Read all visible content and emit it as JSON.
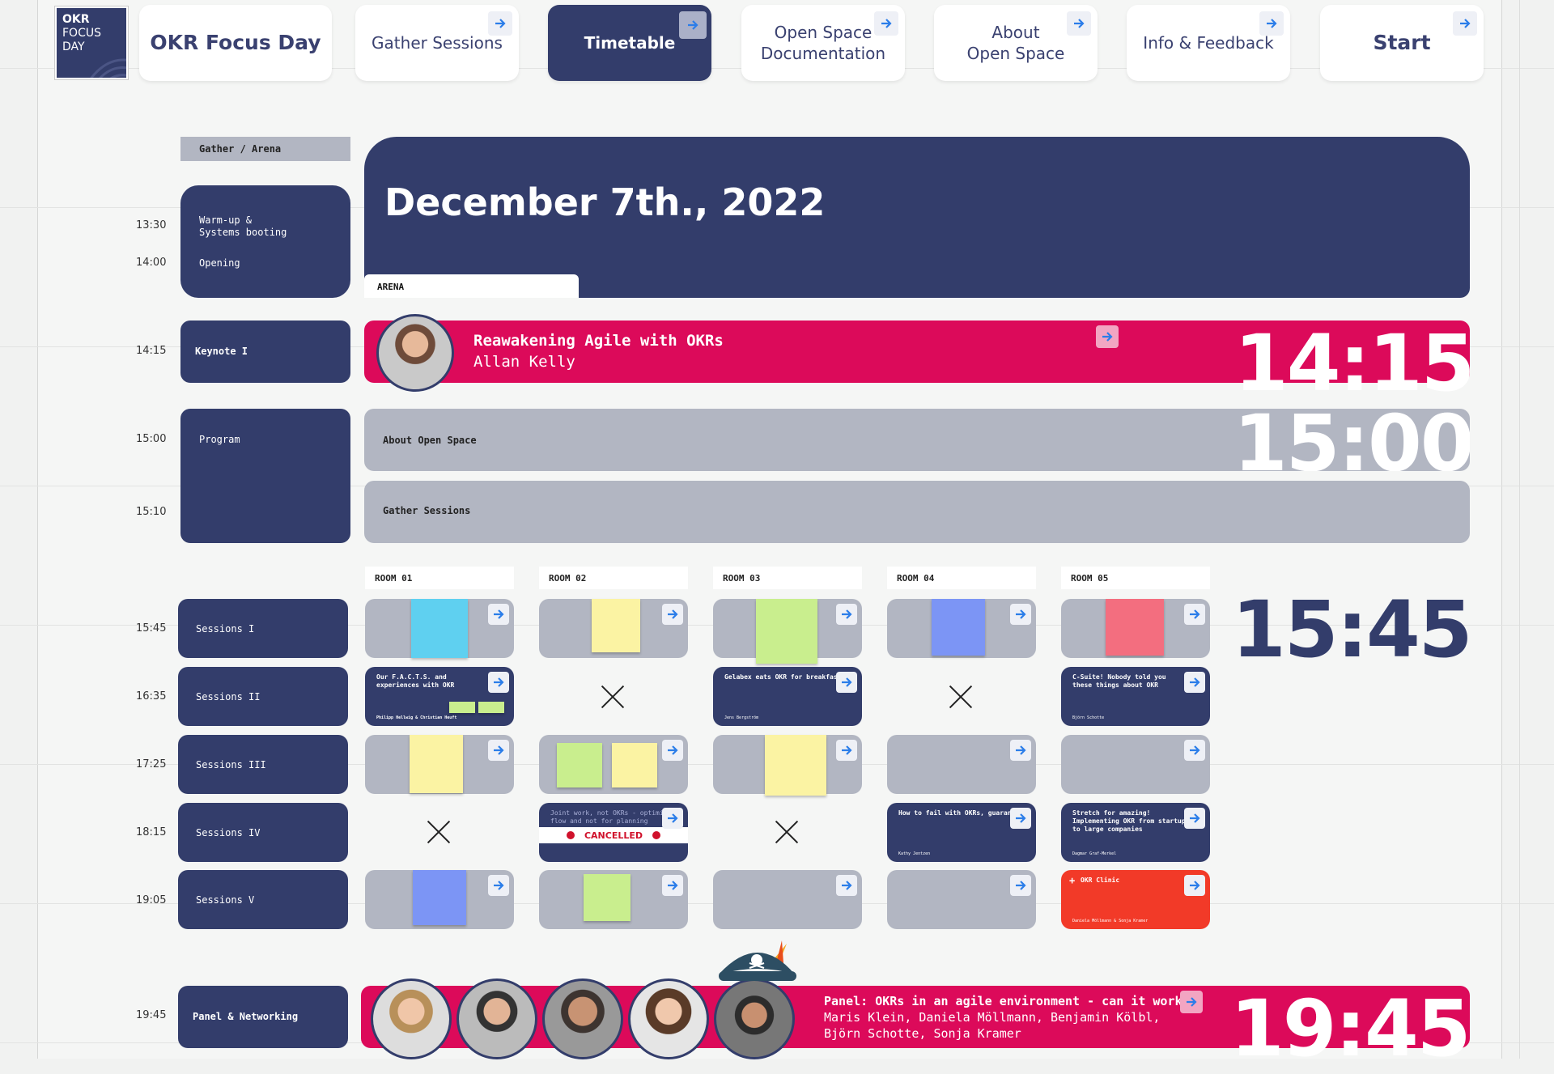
{
  "logo": {
    "line1": "OKR",
    "line2": "FOCUS",
    "line3": "DAY"
  },
  "nav": {
    "title": "OKR Focus Day",
    "gather": "Gather Sessions",
    "timetable": "Timetable",
    "open_space_doc": "Open Space\nDocumentation",
    "about_open_space": "About\nOpen Space",
    "info_feedback": "Info & Feedback",
    "start": "Start"
  },
  "header": {
    "location_tag": "Gather / Arena",
    "date": "December 7th., 2022",
    "arena_tab": "ARENA"
  },
  "times": {
    "t1330": "13:30",
    "t1400": "14:00",
    "t1415": "14:15",
    "t1500": "15:00",
    "t1510": "15:10",
    "t1545": "15:45",
    "t1635": "16:35",
    "t1725": "17:25",
    "t1815": "18:15",
    "t1905": "19:05",
    "t1945": "19:45"
  },
  "slots": {
    "warmup": "Warm-up &\nSystems booting",
    "opening": "Opening",
    "keynote": "Keynote I",
    "program": "Program",
    "s1": "Sessions I",
    "s2": "Sessions II",
    "s3": "Sessions III",
    "s4": "Sessions IV",
    "s5": "Sessions V",
    "panel": "Panel & Networking"
  },
  "keynote": {
    "title": "Reawakening Agile with OKRs",
    "speaker": "Allan Kelly",
    "time": "14:15"
  },
  "program": {
    "about": "About Open Space",
    "gather": "Gather Sessions",
    "time": "15:00"
  },
  "rooms": [
    "ROOM 01",
    "ROOM 02",
    "ROOM 03",
    "ROOM 04",
    "ROOM 05"
  ],
  "sessions_time": "15:45",
  "sessions": {
    "r1s2_title": "Our F.A.C.T.S. and experiences with OKR",
    "r1s2_authors": "Philipp Hellwig & Christian Heuft",
    "r3s2_title": "Gelabex eats OKR for breakfast",
    "r3s2_author": "Jens Bergström",
    "r5s2_title": "C-Suite! Nobody told you these things about OKR",
    "r5s2_author": "Björn Schotte",
    "r2s4_title": "Joint work, not OKRs - optimize flow and not for planning",
    "r2s4_status": "CANCELLED",
    "r4s4_title": "How to fail with OKRs, guaranteed",
    "r4s4_author": "Kathy Jentzen",
    "r5s4_title": "Stretch for amazing! Implementing OKR from startups to large companies",
    "r5s4_author": "Dagmar Graf-Merkel",
    "r5s5_title": "OKR Clinic",
    "r5s5_authors": "Daniela Möllmann & Sonja Kramer"
  },
  "panel": {
    "title": "Panel: OKRs in an agile environment - can it work?",
    "speakers_line1": "Maris Klein, Daniela Möllmann, Benjamin Kölbl,",
    "speakers_line2": "Björn Schotte, Sonja Kramer",
    "time": "19:45"
  },
  "colors": {
    "navy": "#333d6b",
    "magenta": "#dc0a5a",
    "gray": "#b2b6c2",
    "red": "#f23a28"
  }
}
